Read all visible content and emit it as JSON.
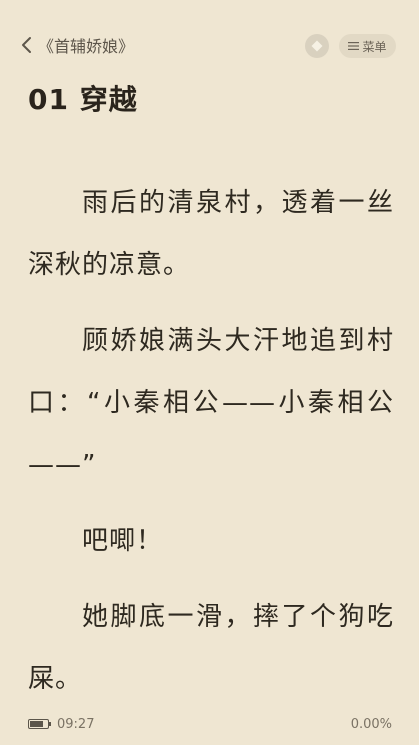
{
  "header": {
    "back_label": "《首辅娇娘》",
    "menu_label": "菜单",
    "icons": {
      "back": "chevron-left-icon",
      "circle": "diamond-icon",
      "menu": "list-icon"
    }
  },
  "chapter": {
    "title": "01 穿越",
    "paragraphs": [
      "雨后的清泉村，透着一丝深秋的凉意。",
      "顾娇娘满头大汗地追到村口：“小秦相公——小秦相公——”",
      "吧唧！",
      "她脚底一滑，摔了个狗吃屎。"
    ]
  },
  "status": {
    "time": "09:27",
    "progress": "0.00%",
    "battery_level": 0.75
  },
  "colors": {
    "background": "#efe6d2",
    "text": "#2f2a22"
  }
}
